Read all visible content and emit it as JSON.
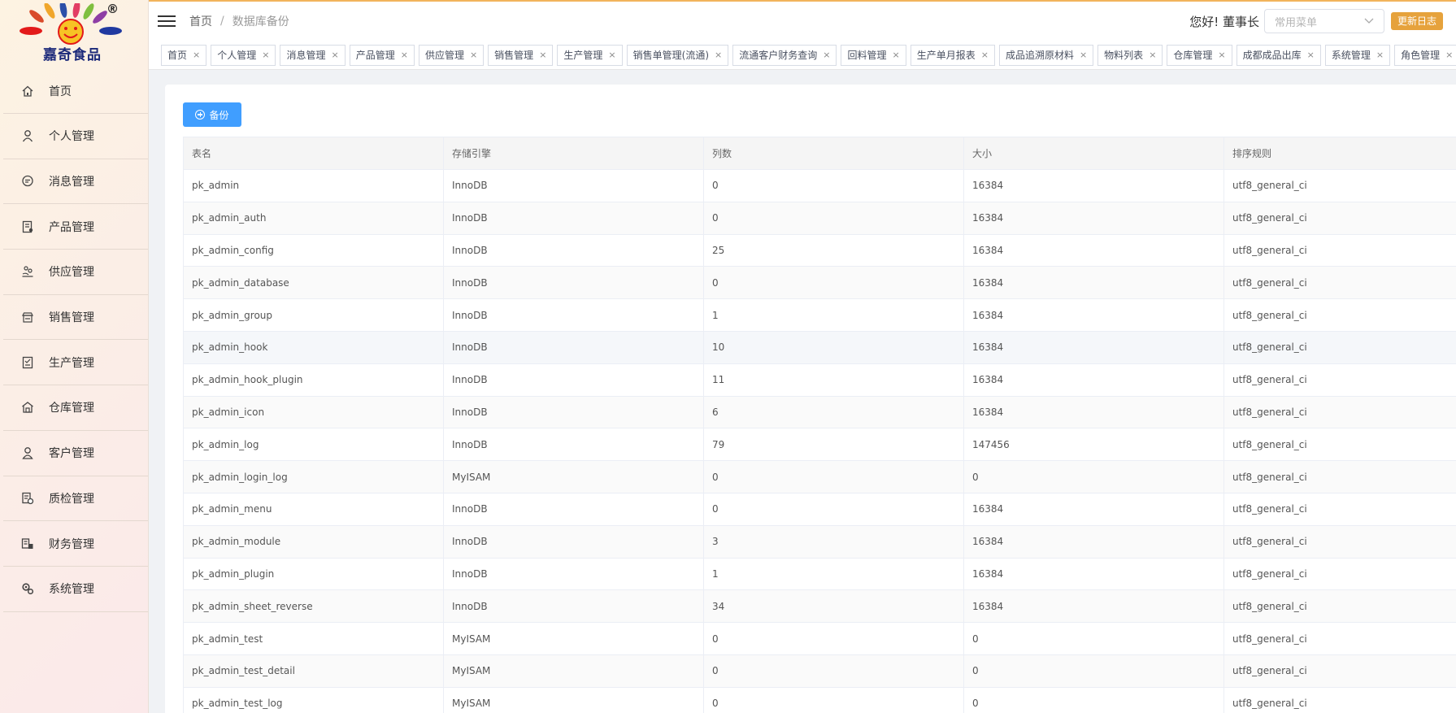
{
  "brand": {
    "name": "嘉奇食品",
    "reg_mark": "®"
  },
  "sidebar": {
    "items": [
      {
        "label": "首页",
        "icon": "home-icon"
      },
      {
        "label": "个人管理",
        "icon": "user-icon"
      },
      {
        "label": "消息管理",
        "icon": "message-icon"
      },
      {
        "label": "产品管理",
        "icon": "product-icon"
      },
      {
        "label": "供应管理",
        "icon": "supply-icon"
      },
      {
        "label": "销售管理",
        "icon": "sales-icon"
      },
      {
        "label": "生产管理",
        "icon": "production-icon"
      },
      {
        "label": "仓库管理",
        "icon": "warehouse-icon"
      },
      {
        "label": "客户管理",
        "icon": "customer-icon"
      },
      {
        "label": "质检管理",
        "icon": "quality-icon"
      },
      {
        "label": "财务管理",
        "icon": "finance-icon"
      },
      {
        "label": "系统管理",
        "icon": "settings-icon"
      }
    ]
  },
  "header": {
    "breadcrumb": [
      "首页",
      "数据库备份"
    ],
    "breadcrumb_sep": "/",
    "greeting": "您好!  董事长",
    "menu_select_placeholder": "常用菜单",
    "update_log_label": "更新日志"
  },
  "tags": [
    "首页",
    "个人管理",
    "消息管理",
    "产品管理",
    "供应管理",
    "销售管理",
    "生产管理",
    "销售单管理(流通)",
    "流通客户财务查询",
    "回料管理",
    "生产单月报表",
    "成品追溯原材料",
    "物料列表",
    "仓库管理",
    "成都成品出库",
    "系统管理",
    "角色管理"
  ],
  "tag_close": "×",
  "content": {
    "backup_label": "备份",
    "table": {
      "headers": [
        "表名",
        "存储引擎",
        "列数",
        "大小",
        "排序规则"
      ],
      "rows": [
        [
          "pk_admin",
          "InnoDB",
          "0",
          "16384",
          "utf8_general_ci"
        ],
        [
          "pk_admin_auth",
          "InnoDB",
          "0",
          "16384",
          "utf8_general_ci"
        ],
        [
          "pk_admin_config",
          "InnoDB",
          "25",
          "16384",
          "utf8_general_ci"
        ],
        [
          "pk_admin_database",
          "InnoDB",
          "0",
          "16384",
          "utf8_general_ci"
        ],
        [
          "pk_admin_group",
          "InnoDB",
          "1",
          "16384",
          "utf8_general_ci"
        ],
        [
          "pk_admin_hook",
          "InnoDB",
          "10",
          "16384",
          "utf8_general_ci"
        ],
        [
          "pk_admin_hook_plugin",
          "InnoDB",
          "11",
          "16384",
          "utf8_general_ci"
        ],
        [
          "pk_admin_icon",
          "InnoDB",
          "6",
          "16384",
          "utf8_general_ci"
        ],
        [
          "pk_admin_log",
          "InnoDB",
          "79",
          "147456",
          "utf8_general_ci"
        ],
        [
          "pk_admin_login_log",
          "MyISAM",
          "0",
          "0",
          "utf8_general_ci"
        ],
        [
          "pk_admin_menu",
          "InnoDB",
          "0",
          "16384",
          "utf8_general_ci"
        ],
        [
          "pk_admin_module",
          "InnoDB",
          "3",
          "16384",
          "utf8_general_ci"
        ],
        [
          "pk_admin_plugin",
          "InnoDB",
          "1",
          "16384",
          "utf8_general_ci"
        ],
        [
          "pk_admin_sheet_reverse",
          "InnoDB",
          "34",
          "16384",
          "utf8_general_ci"
        ],
        [
          "pk_admin_test",
          "MyISAM",
          "0",
          "0",
          "utf8_general_ci"
        ],
        [
          "pk_admin_test_detail",
          "MyISAM",
          "0",
          "0",
          "utf8_general_ci"
        ],
        [
          "pk_admin_test_log",
          "MyISAM",
          "0",
          "0",
          "utf8_general_ci"
        ]
      ]
    }
  },
  "colors": {
    "primary": "#409eff",
    "update_button": "#e6a23c",
    "header_accent": "#f2b45c",
    "brand_text": "#1c2a7a"
  }
}
